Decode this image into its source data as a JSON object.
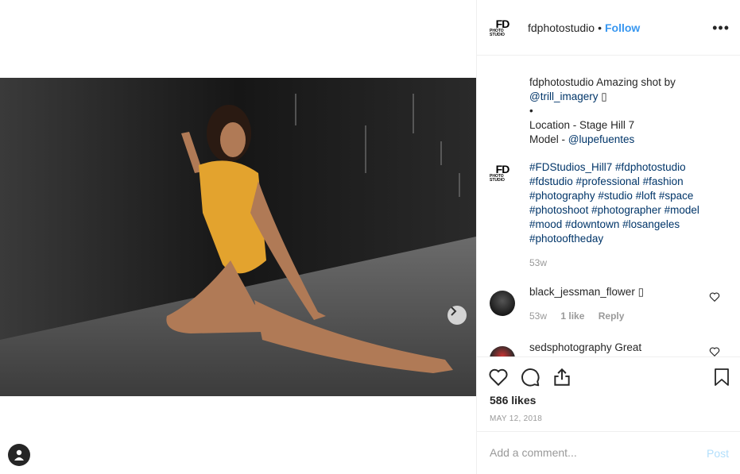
{
  "post": {
    "likes": "586 likes",
    "date": "MAY 12, 2018"
  },
  "header": {
    "logo_line1": "FD",
    "logo_line2": "PHOTO STUDIO",
    "username": "fdphotostudio",
    "separator": "•",
    "follow_label": "Follow",
    "more_label": "•••"
  },
  "caption": {
    "username": "fdphotostudio",
    "text": " Amazing shot by ",
    "mention": "@trill_imagery",
    "emoji": " ▯",
    "bullet": "•",
    "location": "Location - Stage Hill 7",
    "model_prefix": "Model - ",
    "model_mention": "@lupefuentes"
  },
  "hashtags": [
    "#FDStudios_Hill7 #fdphotostudio",
    "#fdstudio #professional #fashion",
    "#photography #studio #loft #space",
    "#photoshoot #photographer #model",
    "#mood #downtown #losangeles",
    "#photooftheday"
  ],
  "caption_time": "53w",
  "comments": [
    {
      "username": "black_jessman_flower",
      "text": " ▯",
      "time": "53w",
      "likes": "1 like",
      "reply": "Reply"
    },
    {
      "username": "sedsphotography",
      "text": " Great"
    }
  ],
  "add_comment": {
    "placeholder": "Add a comment...",
    "post_label": "Post"
  },
  "colors": {
    "link": "#003569",
    "follow": "#3897f0",
    "muted": "#999999",
    "swimsuit": "#e0a030"
  },
  "icons": [
    "heart-icon",
    "comment-icon",
    "share-icon",
    "bookmark-icon",
    "chevron-right-icon",
    "user-icon",
    "more-icon"
  ]
}
